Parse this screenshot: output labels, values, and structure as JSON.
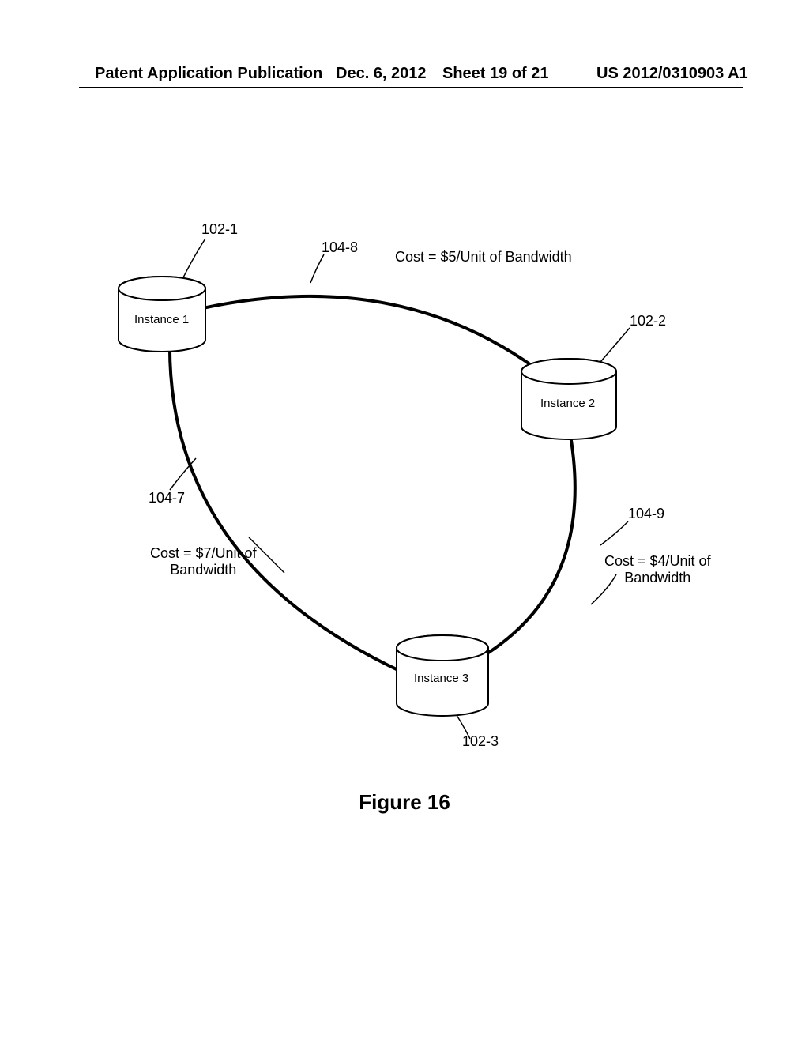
{
  "header": {
    "left": "Patent Application Publication",
    "date": "Dec. 6, 2012",
    "sheet": "Sheet 19 of 21",
    "pubno": "US 2012/0310903 A1"
  },
  "figure": {
    "caption": "Figure 16",
    "nodes": {
      "inst1": {
        "ref": "102-1",
        "label": "Instance 1"
      },
      "inst2": {
        "ref": "102-2",
        "label": "Instance 2"
      },
      "inst3": {
        "ref": "102-3",
        "label": "Instance 3"
      }
    },
    "links": {
      "l8": {
        "ref": "104-8",
        "cost": "Cost = $5/Unit of Bandwidth"
      },
      "l7": {
        "ref": "104-7",
        "cost": "Cost = $7/Unit of\nBandwidth"
      },
      "l9": {
        "ref": "104-9",
        "cost": "Cost = $4/Unit of\nBandwidth"
      }
    }
  }
}
